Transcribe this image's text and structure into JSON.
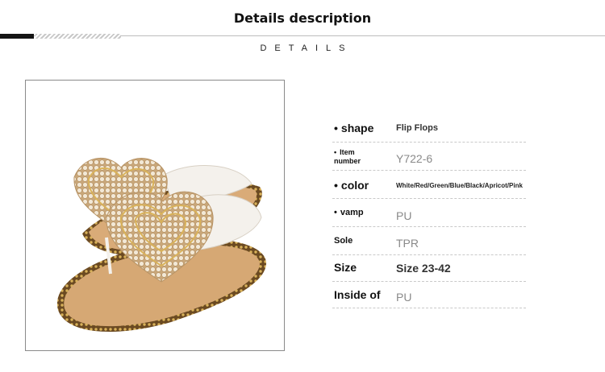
{
  "header": {
    "title": "Details description",
    "subtitle": "DETAILS"
  },
  "product_image": {
    "description_icon": "pearl-heart-flip-flop-sandals"
  },
  "specs": {
    "bullet": "•",
    "shape": {
      "label": "shape",
      "value": "Flip Flops"
    },
    "item": {
      "label_line1": "Item",
      "label_line2": "number",
      "value": "Y722-6"
    },
    "color": {
      "label": "color",
      "value": "White/Red/Green/Blue/Black/Apricot/Pink"
    },
    "vamp": {
      "label": "vamp",
      "value": "PU"
    },
    "sole": {
      "label": "Sole",
      "value": "TPR"
    },
    "size": {
      "label": "Size",
      "value": "Size 23-42"
    },
    "inside": {
      "label": "Inside of",
      "value": "PU"
    }
  },
  "colors": {
    "divider": "#bdbdbd",
    "value_grey": "#8a8a8a",
    "sole_tan": "#d6a874",
    "strap_white": "#f4f1ec",
    "pearl": "#e9dcc4"
  }
}
